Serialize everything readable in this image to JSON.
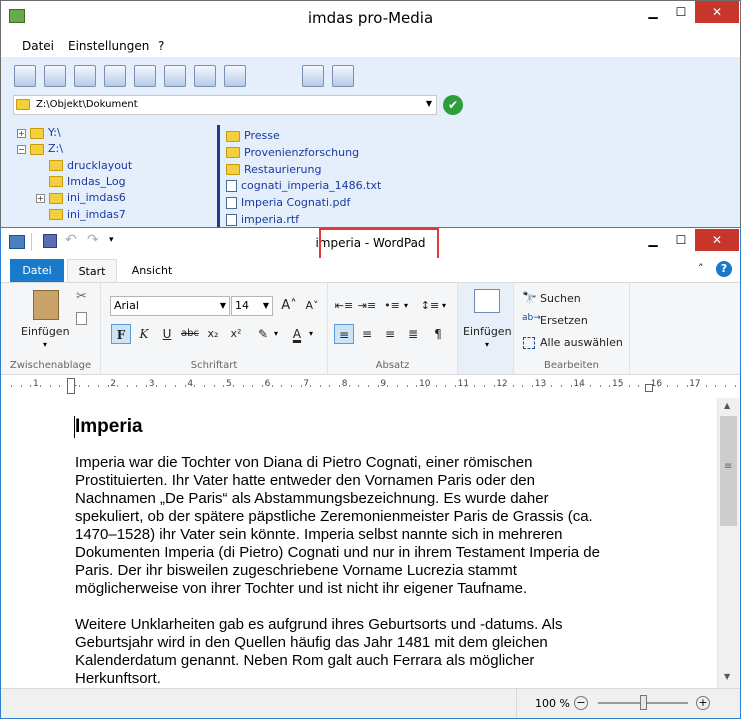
{
  "back_window": {
    "title": "imdas pro-Media",
    "menu": [
      "Datei",
      "Einstellungen",
      "?"
    ],
    "path": "Z:\\Objekt\\Dokument",
    "tree": [
      {
        "label": "Y:\\",
        "depth": 0,
        "expander": "+"
      },
      {
        "label": "Z:\\",
        "depth": 0,
        "expander": "−"
      },
      {
        "label": "drucklayout",
        "depth": 1,
        "expander": ""
      },
      {
        "label": "Imdas_Log",
        "depth": 1,
        "expander": ""
      },
      {
        "label": "ini_imdas6",
        "depth": 1,
        "expander": "+"
      },
      {
        "label": "ini_imdas7",
        "depth": 1,
        "expander": ""
      }
    ],
    "files": [
      {
        "label": "Presse",
        "kind": "folder"
      },
      {
        "label": "Provenienzforschung",
        "kind": "folder"
      },
      {
        "label": "Restaurierung",
        "kind": "folder"
      },
      {
        "label": "cognati_imperia_1486.txt",
        "kind": "file"
      },
      {
        "label": "Imperia Cognati.pdf",
        "kind": "file"
      },
      {
        "label": "imperia.rtf",
        "kind": "file"
      }
    ]
  },
  "front_window": {
    "title": "imperia - WordPad",
    "tabs": {
      "file": "Datei",
      "start": "Start",
      "view": "Ansicht"
    },
    "ribbon": {
      "clipboard": {
        "label": "Zwischenablage",
        "paste": "Einfügen"
      },
      "font": {
        "label": "Schriftart",
        "family": "Arial",
        "size": "14"
      },
      "paragraph": {
        "label": "Absatz"
      },
      "insert": {
        "paste": "Einfügen"
      },
      "edit": {
        "label": "Bearbeiten",
        "find": "Suchen",
        "replace": "Ersetzen",
        "select_all": "Alle auswählen"
      }
    },
    "ruler_labels": [
      "1",
      "1",
      "2",
      "3",
      "4",
      "5",
      "6",
      "7",
      "8",
      "9",
      "10",
      "11",
      "12",
      "13",
      "14",
      "15",
      "16",
      "17"
    ],
    "document": {
      "heading": "Imperia",
      "p1": [
        "Imperia war die Tochter von Diana di Pietro Cognati, einer römischen",
        "Prostituierten. Ihr Vater hatte entweder den Vornamen Paris oder den",
        "Nachnamen „De Paris“ als Abstammungsbezeichnung. Es wurde daher",
        "spekuliert, ob der spätere päpstliche Zeremonienmeister Paris de Grassis (ca.",
        "1470–1528) ihr Vater sein könnte. Imperia selbst nannte sich in mehreren",
        "Dokumenten Imperia (di Pietro) Cognati und nur in ihrem Testament Imperia de",
        "Paris. Der ihr bisweilen zugeschriebene Vorname Lucrezia stammt",
        "möglicherweise von ihrer Tochter und ist nicht ihr eigener Taufname."
      ],
      "p2": [
        "Weitere Unklarheiten gab es aufgrund ihres Geburtsorts und -datums. Als",
        "Geburtsjahr wird in den Quellen häufig das Jahr 1481 mit dem gleichen",
        "Kalenderdatum genannt. Neben Rom galt auch Ferrara als möglicher",
        "Herkunftsort."
      ]
    },
    "status": {
      "zoom": "100 %",
      "zoom_fraction": 0.5
    }
  }
}
